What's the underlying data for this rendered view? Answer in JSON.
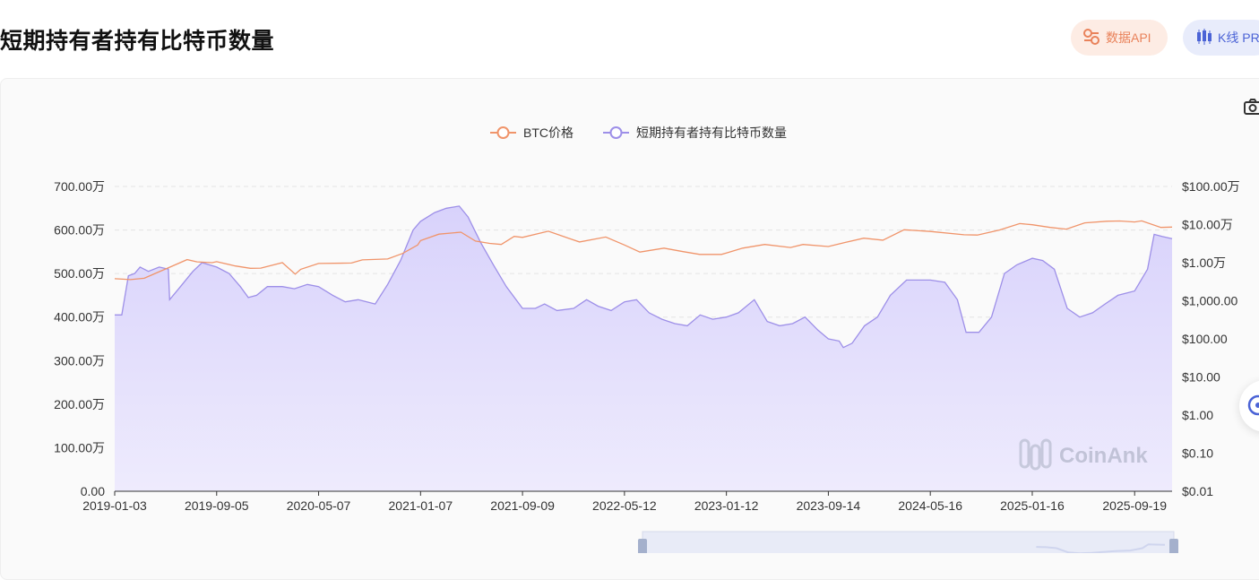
{
  "page": {
    "title": "短期持有者持有比特币数量"
  },
  "header": {
    "api_button": {
      "label": "数据API",
      "icon": "api-icon"
    },
    "kline_button": {
      "label": "K线 PR",
      "icon": "candlestick-icon"
    }
  },
  "toolbar": {
    "camera_icon": "camera-icon"
  },
  "colors": {
    "price": "#f0946a",
    "holdings_line": "#9d8fe8",
    "holdings_fill": "#d8d2fb",
    "axis": "#333333"
  },
  "watermark": "CoinAnk",
  "chart_data": {
    "type": "area",
    "legend_position": "top-center",
    "grid": true,
    "x_tick_labels": [
      "2019-01-03",
      "2019-09-05",
      "2020-05-07",
      "2021-01-07",
      "2021-09-09",
      "2022-05-12",
      "2023-01-12",
      "2023-09-14",
      "2024-05-16",
      "2025-01-16",
      "2025-09-19"
    ],
    "x_range": [
      "2019-01-03",
      "2025-12-18"
    ],
    "left_axis": {
      "ticks": [
        0,
        1000000,
        2000000,
        3000000,
        4000000,
        5000000,
        6000000,
        7000000
      ],
      "tick_labels": [
        "0.00",
        "100.00万",
        "200.00万",
        "300.00万",
        "400.00万",
        "500.00万",
        "600.00万",
        "700.00万"
      ],
      "ylim": [
        0,
        7000000
      ]
    },
    "right_axis": {
      "scale": "log",
      "ticks": [
        0.01,
        0.1,
        1,
        10,
        100,
        1000,
        10000,
        100000,
        1000000
      ],
      "tick_labels": [
        "$0.01",
        "$0.10",
        "$1.00",
        "$10.00",
        "$100.00",
        "$1,000.00",
        "$1.00万",
        "$10.00万",
        "$100.00万"
      ],
      "ylim": [
        0.01,
        1000000
      ]
    },
    "series": [
      {
        "name": "BTC价格",
        "axis": "right",
        "points": [
          [
            "2019-01-03",
            3800
          ],
          [
            "2019-02-10",
            3600
          ],
          [
            "2019-03-15",
            3900
          ],
          [
            "2019-04-10",
            5200
          ],
          [
            "2019-05-20",
            8000
          ],
          [
            "2019-06-26",
            12000
          ],
          [
            "2019-07-20",
            10500
          ],
          [
            "2019-08-25",
            10000
          ],
          [
            "2019-09-05",
            10600
          ],
          [
            "2019-10-20",
            8200
          ],
          [
            "2019-11-25",
            7100
          ],
          [
            "2019-12-20",
            7200
          ],
          [
            "2020-02-10",
            10000
          ],
          [
            "2020-03-12",
            5000
          ],
          [
            "2020-03-25",
            6700
          ],
          [
            "2020-05-07",
            9500
          ],
          [
            "2020-07-25",
            9800
          ],
          [
            "2020-08-20",
            11800
          ],
          [
            "2020-10-20",
            12500
          ],
          [
            "2020-11-25",
            17500
          ],
          [
            "2020-12-31",
            29000
          ],
          [
            "2021-01-07",
            38000
          ],
          [
            "2021-02-20",
            56000
          ],
          [
            "2021-04-14",
            63000
          ],
          [
            "2021-05-19",
            37000
          ],
          [
            "2021-06-22",
            32000
          ],
          [
            "2021-07-20",
            30000
          ],
          [
            "2021-08-20",
            49000
          ],
          [
            "2021-09-09",
            46000
          ],
          [
            "2021-11-10",
            67000
          ],
          [
            "2021-12-20",
            47000
          ],
          [
            "2022-01-24",
            35000
          ],
          [
            "2022-03-28",
            47000
          ],
          [
            "2022-05-12",
            29000
          ],
          [
            "2022-06-18",
            19000
          ],
          [
            "2022-08-15",
            24000
          ],
          [
            "2022-09-30",
            19500
          ],
          [
            "2022-11-09",
            16500
          ],
          [
            "2022-12-31",
            16500
          ],
          [
            "2023-01-12",
            18000
          ],
          [
            "2023-02-20",
            24000
          ],
          [
            "2023-04-14",
            30000
          ],
          [
            "2023-06-15",
            25000
          ],
          [
            "2023-07-15",
            30000
          ],
          [
            "2023-09-14",
            26500
          ],
          [
            "2023-10-25",
            34000
          ],
          [
            "2023-12-08",
            44000
          ],
          [
            "2024-01-23",
            39000
          ],
          [
            "2024-03-14",
            73000
          ],
          [
            "2024-05-16",
            66000
          ],
          [
            "2024-08-05",
            54000
          ],
          [
            "2024-09-06",
            53000
          ],
          [
            "2024-10-29",
            72000
          ],
          [
            "2024-12-17",
            106000
          ],
          [
            "2025-01-16",
            99000
          ],
          [
            "2025-02-28",
            84000
          ],
          [
            "2025-04-08",
            76000
          ],
          [
            "2025-05-22",
            111000
          ],
          [
            "2025-07-14",
            122000
          ],
          [
            "2025-08-14",
            124000
          ],
          [
            "2025-09-19",
            117000
          ],
          [
            "2025-10-06",
            125000
          ],
          [
            "2025-11-21",
            84000
          ],
          [
            "2025-12-18",
            86000
          ]
        ]
      },
      {
        "name": "短期持有者持有比特币数量",
        "axis": "left",
        "points": [
          [
            "2019-01-03",
            4050000
          ],
          [
            "2019-01-20",
            4050000
          ],
          [
            "2019-01-28",
            4500000
          ],
          [
            "2019-02-05",
            4950000
          ],
          [
            "2019-02-20",
            5000000
          ],
          [
            "2019-03-05",
            5150000
          ],
          [
            "2019-03-25",
            5050000
          ],
          [
            "2019-04-20",
            5150000
          ],
          [
            "2019-05-12",
            5100000
          ],
          [
            "2019-05-15",
            4400000
          ],
          [
            "2019-06-10",
            4700000
          ],
          [
            "2019-07-10",
            5050000
          ],
          [
            "2019-08-01",
            5250000
          ],
          [
            "2019-09-05",
            5150000
          ],
          [
            "2019-10-05",
            5000000
          ],
          [
            "2019-11-01",
            4700000
          ],
          [
            "2019-11-20",
            4450000
          ],
          [
            "2019-12-10",
            4500000
          ],
          [
            "2020-01-05",
            4700000
          ],
          [
            "2020-02-10",
            4700000
          ],
          [
            "2020-03-10",
            4650000
          ],
          [
            "2020-04-10",
            4750000
          ],
          [
            "2020-05-07",
            4700000
          ],
          [
            "2020-06-10",
            4500000
          ],
          [
            "2020-07-10",
            4350000
          ],
          [
            "2020-08-10",
            4400000
          ],
          [
            "2020-09-20",
            4300000
          ],
          [
            "2020-10-20",
            4750000
          ],
          [
            "2020-11-20",
            5300000
          ],
          [
            "2020-12-20",
            6000000
          ],
          [
            "2021-01-07",
            6200000
          ],
          [
            "2021-02-10",
            6400000
          ],
          [
            "2021-03-10",
            6500000
          ],
          [
            "2021-04-10",
            6550000
          ],
          [
            "2021-05-01",
            6300000
          ],
          [
            "2021-06-01",
            5700000
          ],
          [
            "2021-07-01",
            5200000
          ],
          [
            "2021-08-01",
            4700000
          ],
          [
            "2021-09-09",
            4200000
          ],
          [
            "2021-10-10",
            4200000
          ],
          [
            "2021-11-01",
            4300000
          ],
          [
            "2021-12-01",
            4150000
          ],
          [
            "2022-01-10",
            4200000
          ],
          [
            "2022-02-10",
            4400000
          ],
          [
            "2022-03-10",
            4250000
          ],
          [
            "2022-04-10",
            4150000
          ],
          [
            "2022-05-12",
            4350000
          ],
          [
            "2022-06-10",
            4400000
          ],
          [
            "2022-07-10",
            4100000
          ],
          [
            "2022-08-10",
            3950000
          ],
          [
            "2022-09-10",
            3850000
          ],
          [
            "2022-10-10",
            3800000
          ],
          [
            "2022-11-10",
            4050000
          ],
          [
            "2022-12-10",
            3950000
          ],
          [
            "2023-01-12",
            4000000
          ],
          [
            "2023-02-10",
            4100000
          ],
          [
            "2023-03-20",
            4400000
          ],
          [
            "2023-04-20",
            3900000
          ],
          [
            "2023-05-20",
            3800000
          ],
          [
            "2023-06-20",
            3850000
          ],
          [
            "2023-07-20",
            4000000
          ],
          [
            "2023-08-20",
            3700000
          ],
          [
            "2023-09-14",
            3500000
          ],
          [
            "2023-10-10",
            3450000
          ],
          [
            "2023-10-20",
            3300000
          ],
          [
            "2023-11-10",
            3400000
          ],
          [
            "2023-12-10",
            3800000
          ],
          [
            "2024-01-10",
            4000000
          ],
          [
            "2024-02-10",
            4500000
          ],
          [
            "2024-03-20",
            4850000
          ],
          [
            "2024-05-16",
            4850000
          ],
          [
            "2024-06-20",
            4800000
          ],
          [
            "2024-07-20",
            4400000
          ],
          [
            "2024-08-10",
            3650000
          ],
          [
            "2024-09-10",
            3650000
          ],
          [
            "2024-10-10",
            4000000
          ],
          [
            "2024-11-10",
            5000000
          ],
          [
            "2024-12-10",
            5200000
          ],
          [
            "2025-01-16",
            5350000
          ],
          [
            "2025-02-10",
            5300000
          ],
          [
            "2025-03-10",
            5100000
          ],
          [
            "2025-04-10",
            4200000
          ],
          [
            "2025-05-10",
            4000000
          ],
          [
            "2025-06-10",
            4100000
          ],
          [
            "2025-07-10",
            4300000
          ],
          [
            "2025-08-10",
            4500000
          ],
          [
            "2025-09-19",
            4600000
          ],
          [
            "2025-10-20",
            5100000
          ],
          [
            "2025-11-05",
            5900000
          ],
          [
            "2025-11-25",
            5850000
          ],
          [
            "2025-12-18",
            5800000
          ]
        ]
      }
    ]
  }
}
